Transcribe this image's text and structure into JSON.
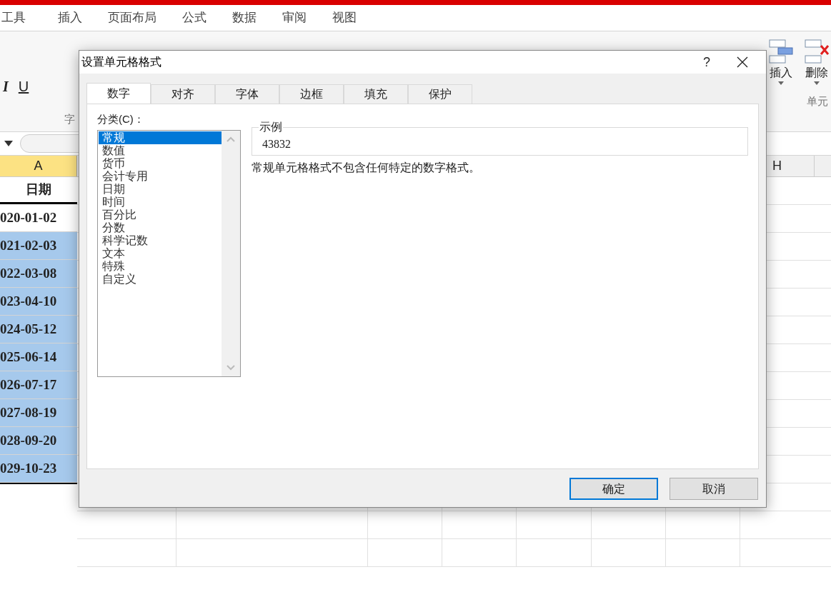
{
  "menu_tabs": [
    "工具",
    "插入",
    "页面布局",
    "公式",
    "数据",
    "审阅",
    "视图"
  ],
  "ribbon": {
    "left_buttons": [
      "I",
      "U"
    ],
    "left_group_label": "字",
    "right_buttons": [
      {
        "label": "插入",
        "kind": "insert"
      },
      {
        "label": "删除",
        "kind": "delete"
      }
    ],
    "right_group_label": "单元"
  },
  "sheet": {
    "column_a": "A",
    "column_h": "H",
    "header": "日期",
    "rows": [
      {
        "value": "020-01-02",
        "selected": false
      },
      {
        "value": "021-02-03",
        "selected": true
      },
      {
        "value": "022-03-08",
        "selected": true
      },
      {
        "value": "023-04-10",
        "selected": true
      },
      {
        "value": "024-05-12",
        "selected": true
      },
      {
        "value": "025-06-14",
        "selected": true
      },
      {
        "value": "026-07-17",
        "selected": true
      },
      {
        "value": "027-08-19",
        "selected": true
      },
      {
        "value": "028-09-20",
        "selected": true
      },
      {
        "value": "029-10-23",
        "selected": true
      }
    ]
  },
  "dialog": {
    "title": "设置单元格格式",
    "help": "?",
    "tabs": [
      {
        "label": "数字",
        "selected": true
      },
      {
        "label": "对齐",
        "selected": false
      },
      {
        "label": "字体",
        "selected": false
      },
      {
        "label": "边框",
        "selected": false
      },
      {
        "label": "填充",
        "selected": false
      },
      {
        "label": "保护",
        "selected": false
      }
    ],
    "category_label": "分类(C)：",
    "categories": [
      {
        "label": "常规",
        "selected": true
      },
      {
        "label": "数值",
        "selected": false
      },
      {
        "label": "货币",
        "selected": false
      },
      {
        "label": "会计专用",
        "selected": false
      },
      {
        "label": "日期",
        "selected": false
      },
      {
        "label": "时间",
        "selected": false
      },
      {
        "label": "百分比",
        "selected": false
      },
      {
        "label": "分数",
        "selected": false
      },
      {
        "label": "科学记数",
        "selected": false
      },
      {
        "label": "文本",
        "selected": false
      },
      {
        "label": "特殊",
        "selected": false
      },
      {
        "label": "自定义",
        "selected": false
      }
    ],
    "sample_label": "示例",
    "sample_value": "43832",
    "description": "常规单元格格式不包含任何特定的数字格式。",
    "buttons": [
      {
        "label": "确定",
        "default": true
      },
      {
        "label": "取消",
        "default": false
      }
    ]
  }
}
